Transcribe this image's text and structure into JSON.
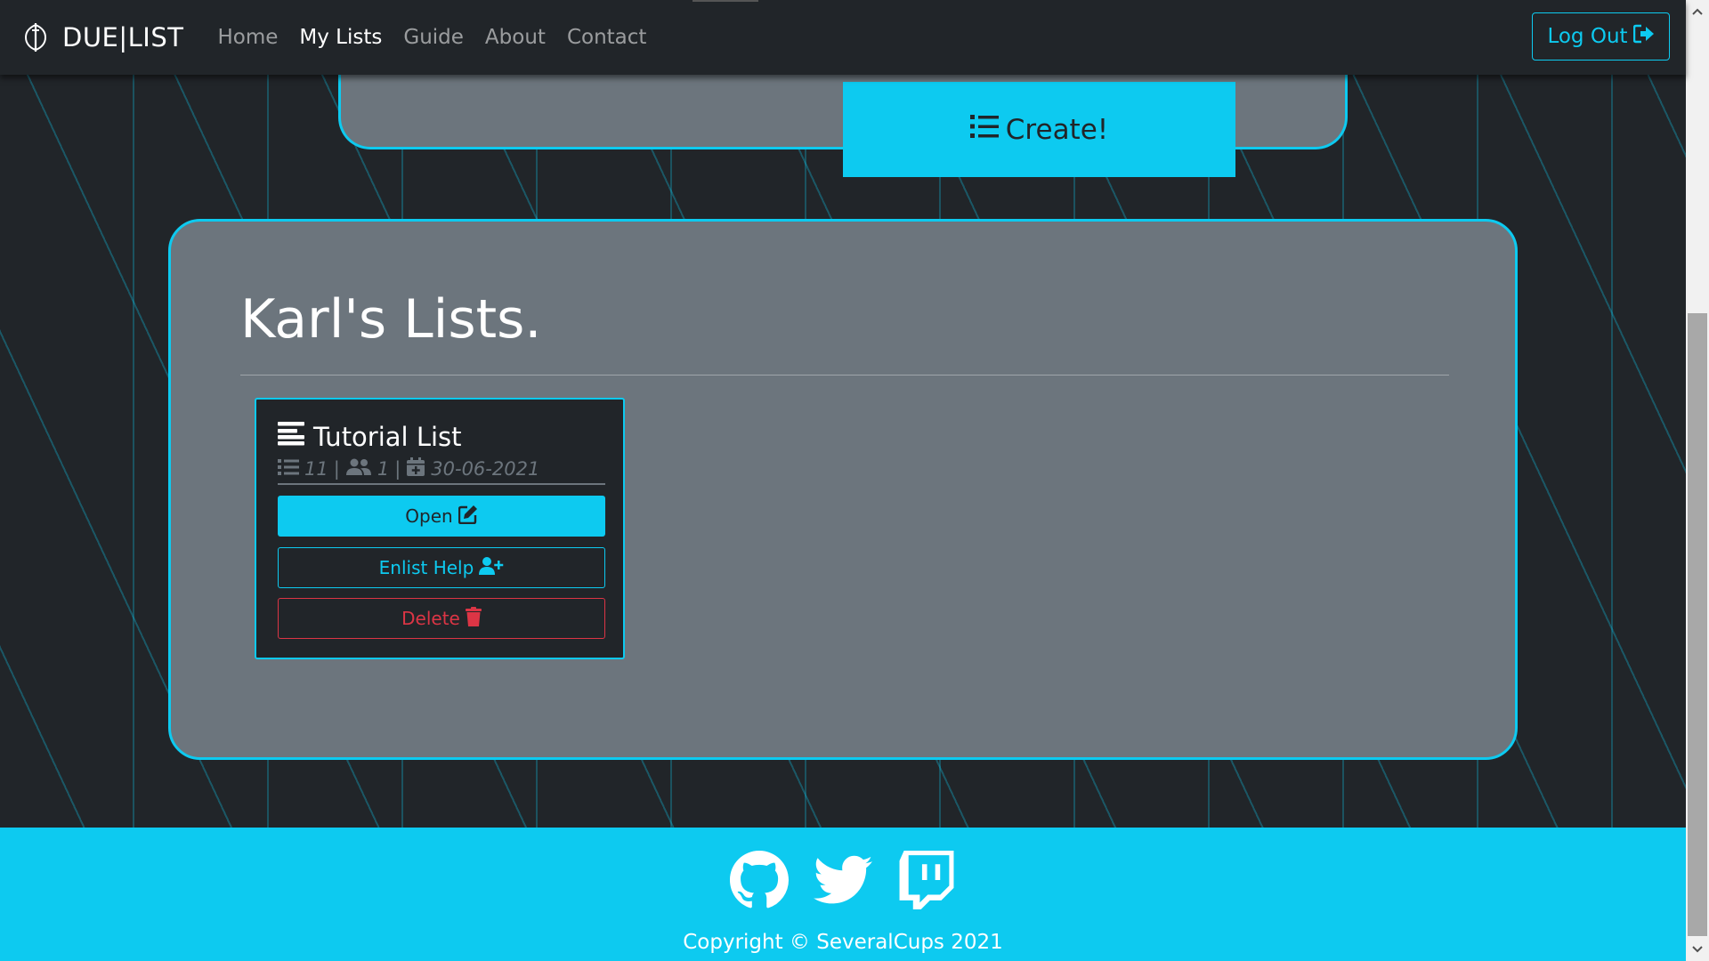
{
  "navbar": {
    "brand_text": "DUE|LIST",
    "brand_icon": "sword-shield-icon",
    "links": [
      "Home",
      "My Lists",
      "Guide",
      "About",
      "Contact"
    ],
    "active_link": "My Lists",
    "logout_label": "Log Out",
    "logout_icon": "sign-out-icon"
  },
  "top_panel": {
    "create_label": "Create!",
    "create_icon": "list-icon"
  },
  "lists_panel": {
    "title": "Karl's Lists.",
    "cards": [
      {
        "title": "Tutorial List",
        "item_count": "11",
        "member_count": "1",
        "date": "30-06-2021",
        "open_label": "Open",
        "enlist_label": "Enlist Help",
        "delete_label": "Delete"
      }
    ]
  },
  "footer": {
    "social_icons": [
      "github-icon",
      "twitter-icon",
      "twitch-icon"
    ],
    "copyright": "Copyright © SeveralCups 2021"
  },
  "colors": {
    "accent": "#0dcaf0",
    "dark": "#212529",
    "panel": "#6c757d",
    "danger": "#dc3545"
  }
}
